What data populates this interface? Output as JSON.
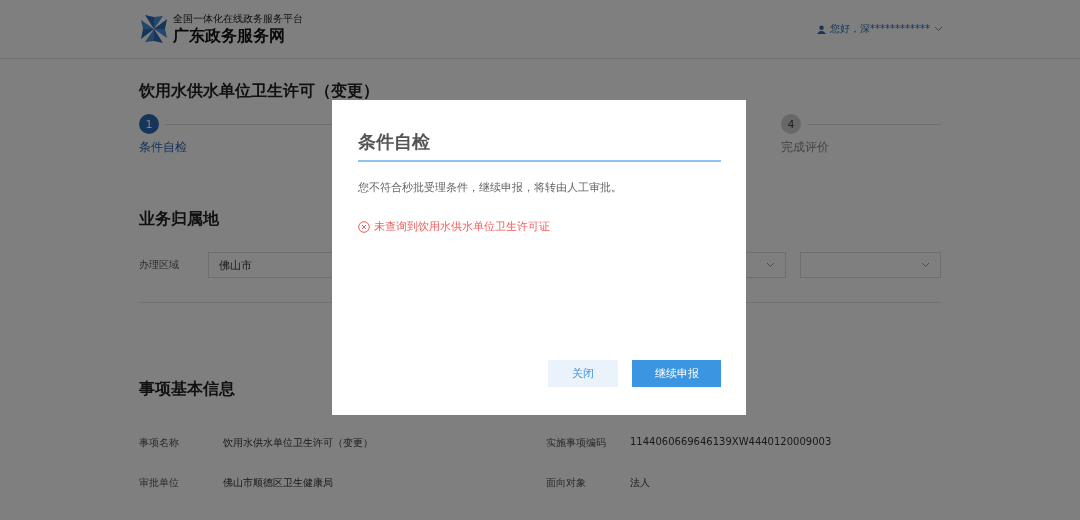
{
  "header": {
    "logo_subtitle": "全国一体化在线政务服务平台",
    "logo_title": "广东政务服务网",
    "greeting": "您好，深************"
  },
  "page_title": "饮用水供水单位卫生许可（变更）",
  "steps": [
    {
      "number": "1",
      "label": "条件自检",
      "selected": true
    },
    {
      "number": "4",
      "label": "完成评价",
      "selected": false
    }
  ],
  "location": {
    "heading": "业务归属地",
    "label": "办理区域",
    "value": "佛山市"
  },
  "basic_info": {
    "heading": "事项基本信息",
    "fields": [
      {
        "label": "事项名称",
        "value": "饮用水供水单位卫生许可（变更）"
      },
      {
        "label": "实施事项编码",
        "value": "1144060669646139XW4440120009003"
      },
      {
        "label": "审批单位",
        "value": "佛山市顺德区卫生健康局"
      },
      {
        "label": "面向对象",
        "value": "法人"
      }
    ]
  },
  "dialog": {
    "title": "条件自检",
    "message": "您不符合秒批受理条件，继续申报，将转由人工审批。",
    "error": "未查询到饮用水供水单位卫生许可证",
    "buttons": [
      {
        "label": "关闭",
        "kind": "secondary"
      },
      {
        "label": "继续申报",
        "kind": "primary"
      }
    ]
  }
}
